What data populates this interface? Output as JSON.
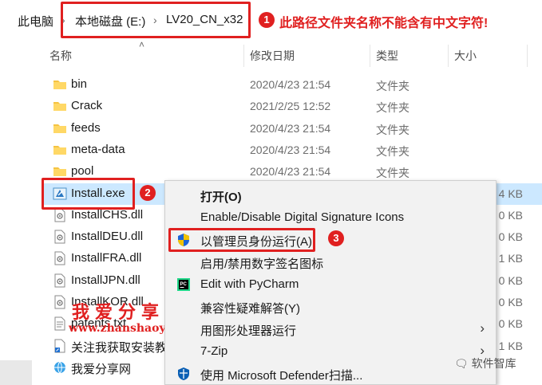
{
  "breadcrumb": {
    "items": [
      "此电脑",
      "本地磁盘 (E:)",
      "LV20_CN_x32"
    ]
  },
  "annotations": {
    "n1": "1",
    "n2": "2",
    "n3": "3",
    "note1": "此路径文件夹名称不能含有中文字符!"
  },
  "columns": {
    "name": "名称",
    "date": "修改日期",
    "type": "类型",
    "size": "大小"
  },
  "files": [
    {
      "name": "bin",
      "date": "2020/4/23 21:54",
      "type": "文件夹",
      "size": "",
      "icon": "folder-icon"
    },
    {
      "name": "Crack",
      "date": "2021/2/25 12:52",
      "type": "文件夹",
      "size": "",
      "icon": "folder-icon"
    },
    {
      "name": "feeds",
      "date": "2020/4/23 21:54",
      "type": "文件夹",
      "size": "",
      "icon": "folder-icon"
    },
    {
      "name": "meta-data",
      "date": "2020/4/23 21:54",
      "type": "文件夹",
      "size": "",
      "icon": "folder-icon"
    },
    {
      "name": "pool",
      "date": "2020/4/23 21:54",
      "type": "文件夹",
      "size": "",
      "icon": "folder-icon"
    },
    {
      "name": "Install.exe",
      "date": "",
      "type": "",
      "size": "4 KB",
      "icon": "installer-icon"
    },
    {
      "name": "InstallCHS.dll",
      "date": "",
      "type": "",
      "size": "0 KB",
      "icon": "dll-icon"
    },
    {
      "name": "InstallDEU.dll",
      "date": "",
      "type": "",
      "size": "0 KB",
      "icon": "dll-icon"
    },
    {
      "name": "InstallFRA.dll",
      "date": "",
      "type": "",
      "size": "1 KB",
      "icon": "dll-icon"
    },
    {
      "name": "InstallJPN.dll",
      "date": "",
      "type": "",
      "size": "0 KB",
      "icon": "dll-icon"
    },
    {
      "name": "InstallKOR.dll",
      "date": "",
      "type": "",
      "size": "0 KB",
      "icon": "dll-icon"
    },
    {
      "name": "patents.txt",
      "date": "",
      "type": "",
      "size": "0 KB",
      "icon": "text-file-icon"
    },
    {
      "name": "关注我获取安装教",
      "date": "",
      "type": "",
      "size": "1 KB",
      "icon": "shortcut-icon"
    },
    {
      "name": "我爱分享网",
      "date": "",
      "type": "",
      "size": "",
      "icon": "internet-shortcut-icon"
    }
  ],
  "context_menu": {
    "items": [
      {
        "label": "打开(O)",
        "icon": "",
        "submenu": false,
        "bold": true
      },
      {
        "label": "Enable/Disable Digital Signature Icons",
        "icon": "",
        "submenu": false
      },
      {
        "label": "以管理员身份运行(A)",
        "icon": "uac-shield-icon",
        "submenu": false
      },
      {
        "label": "启用/禁用数字签名图标",
        "icon": "",
        "submenu": false
      },
      {
        "label": "Edit with PyCharm",
        "icon": "pycharm-icon",
        "submenu": false
      },
      {
        "label": "兼容性疑难解答(Y)",
        "icon": "",
        "submenu": false
      },
      {
        "label": "用图形处理器运行",
        "icon": "",
        "submenu": true
      },
      {
        "label": "7-Zip",
        "icon": "",
        "submenu": true
      },
      {
        "label": "使用 Microsoft Defender扫描...",
        "icon": "defender-icon",
        "submenu": false
      }
    ]
  },
  "watermark": {
    "title": "我爱分享网",
    "url": "www.zhanshaoyi.com",
    "wechat": "软件智库"
  },
  "colors": {
    "annotation_red": "#e02020",
    "selection": "#cce8ff",
    "folder": "#f5c342"
  }
}
